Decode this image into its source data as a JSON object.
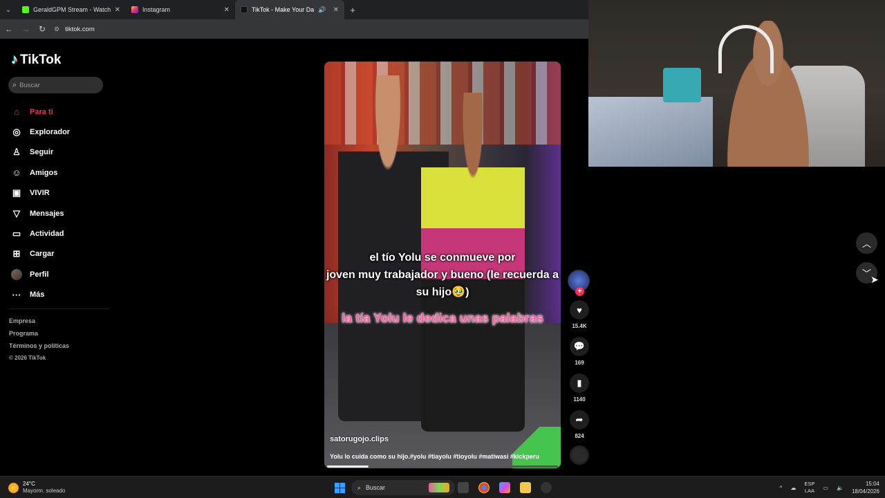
{
  "browser": {
    "tabs": [
      {
        "title": "GeraldGPM Stream - Watch Live",
        "favicon_color": "#53fc18",
        "active": false
      },
      {
        "title": "Instagram",
        "favicon_color": "#e1306c",
        "active": false
      },
      {
        "title": "TikTok - Make Your Day",
        "favicon_color": "#111111",
        "active": true
      }
    ],
    "new_tab_label": "+",
    "url": "tiktok.com"
  },
  "tiktok": {
    "logo_text": "TikTok",
    "search_placeholder": "Buscar",
    "menu": [
      {
        "label": "Para ti",
        "icon": "home-icon",
        "glyph": "⌂",
        "active": true
      },
      {
        "label": "Explorador",
        "icon": "compass-icon",
        "glyph": "◎",
        "active": false
      },
      {
        "label": "Seguir",
        "icon": "follow-icon",
        "glyph": "♙",
        "active": false
      },
      {
        "label": "Amigos",
        "icon": "friends-icon",
        "glyph": "☺",
        "active": false
      },
      {
        "label": "VIVIR",
        "icon": "live-icon",
        "glyph": "▣",
        "active": false
      },
      {
        "label": "Mensajes",
        "icon": "messages-icon",
        "glyph": "▽",
        "active": false
      },
      {
        "label": "Actividad",
        "icon": "activity-icon",
        "glyph": "▭",
        "active": false
      },
      {
        "label": "Cargar",
        "icon": "upload-icon",
        "glyph": "⊞",
        "active": false
      },
      {
        "label": "Perfil",
        "icon": "profile-avatar",
        "glyph": "",
        "active": false
      },
      {
        "label": "Más",
        "icon": "more-icon",
        "glyph": "···",
        "active": false
      }
    ],
    "footer": {
      "links": [
        "Empresa",
        "Programa",
        "Términos y políticas"
      ],
      "copyright": "© 2026 TikTok"
    }
  },
  "video": {
    "caption_white": [
      "el tío Yolu se conmueve por",
      "joven muy trabajador y bueno (le recuerda a",
      "su hijo🥹)"
    ],
    "caption_pink": "la tía Yolu le dedica unas palabras",
    "watermark": "satorugojo.clips",
    "description": "Yolu lo cuida como su hijo.#yolu #tiayolu #tioyolu #matiwasi #kickperu",
    "progress": 0.18
  },
  "actions": {
    "like_count": "15.4K",
    "comment_count": "169",
    "save_count": "1140",
    "share_count": "824",
    "follow_label": "+"
  },
  "taskbar": {
    "weather_temp": "24°C",
    "weather_desc": "Mayorm. soleado",
    "search_placeholder": "Buscar",
    "lang_top": "ESP",
    "lang_bottom": "LAA",
    "time": "15:04",
    "date": "18/04/2026"
  }
}
